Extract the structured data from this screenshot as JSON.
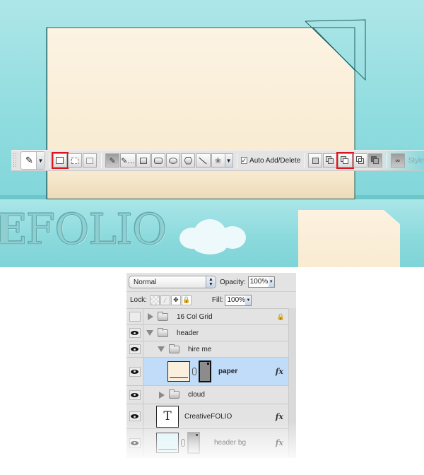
{
  "canvas": {
    "logo_text_bold": "E",
    "logo_text_rest": "FOLIO",
    "colors": {
      "sky": "#8fdcdf",
      "paper": "#fcf3e3",
      "path_stroke": "#1f5e5e",
      "highlight": "#e0141b"
    }
  },
  "options_bar": {
    "preset_icon": "pen-tool-icon",
    "path_modes": [
      {
        "name": "shape-layers",
        "icon": "shape-layers-icon",
        "highlighted": false
      },
      {
        "name": "paths",
        "icon": "paths-icon",
        "highlighted": true
      },
      {
        "name": "fill-pixels",
        "icon": "fill-pixels-icon",
        "highlighted": false
      }
    ],
    "tools": [
      {
        "name": "pen",
        "icon": "pen-icon",
        "pressed": true
      },
      {
        "name": "freeform-pen",
        "icon": "freeform-pen-icon",
        "pressed": false
      },
      {
        "name": "rectangle",
        "icon": "rectangle-icon",
        "pressed": false
      },
      {
        "name": "rounded-rectangle",
        "icon": "rounded-rectangle-icon",
        "pressed": false
      },
      {
        "name": "ellipse",
        "icon": "ellipse-icon",
        "pressed": false
      },
      {
        "name": "polygon",
        "icon": "polygon-icon",
        "pressed": false
      },
      {
        "name": "line",
        "icon": "line-icon",
        "pressed": false
      },
      {
        "name": "custom-shape",
        "icon": "custom-shape-icon",
        "pressed": false
      }
    ],
    "auto_add_delete": {
      "label": "Auto Add/Delete",
      "checked": true
    },
    "combine_modes": [
      {
        "name": "new-area",
        "highlighted": false
      },
      {
        "name": "add-to-area",
        "highlighted": false
      },
      {
        "name": "subtract-from-area",
        "highlighted": true
      },
      {
        "name": "intersect-area",
        "highlighted": false
      },
      {
        "name": "exclude-overlap",
        "highlighted": false
      }
    ],
    "style_label": "Style"
  },
  "layers_panel": {
    "blend_mode": "Normal",
    "opacity_label": "Opacity:",
    "opacity_value": "100%",
    "lock_label": "Lock:",
    "fill_label": "Fill:",
    "fill_value": "100%",
    "layers": [
      {
        "name": "16 Col Grid",
        "type": "group",
        "visible": false,
        "expanded": false,
        "locked": true,
        "indent": 0
      },
      {
        "name": "header",
        "type": "group",
        "visible": true,
        "expanded": true,
        "indent": 0
      },
      {
        "name": "hire me",
        "type": "group",
        "visible": true,
        "expanded": true,
        "indent": 1
      },
      {
        "name": "paper",
        "type": "shape",
        "visible": true,
        "selected": true,
        "fx": "fx",
        "indent": 2
      },
      {
        "name": "cloud",
        "type": "group",
        "visible": true,
        "expanded": false,
        "indent": 1
      },
      {
        "name": "CreativeFOLIO",
        "type": "text",
        "visible": true,
        "fx": "fx",
        "thumb_glyph": "T",
        "indent": 1
      },
      {
        "name": "header bg",
        "type": "shape",
        "visible": true,
        "fx": "fx",
        "indent": 1
      }
    ]
  }
}
